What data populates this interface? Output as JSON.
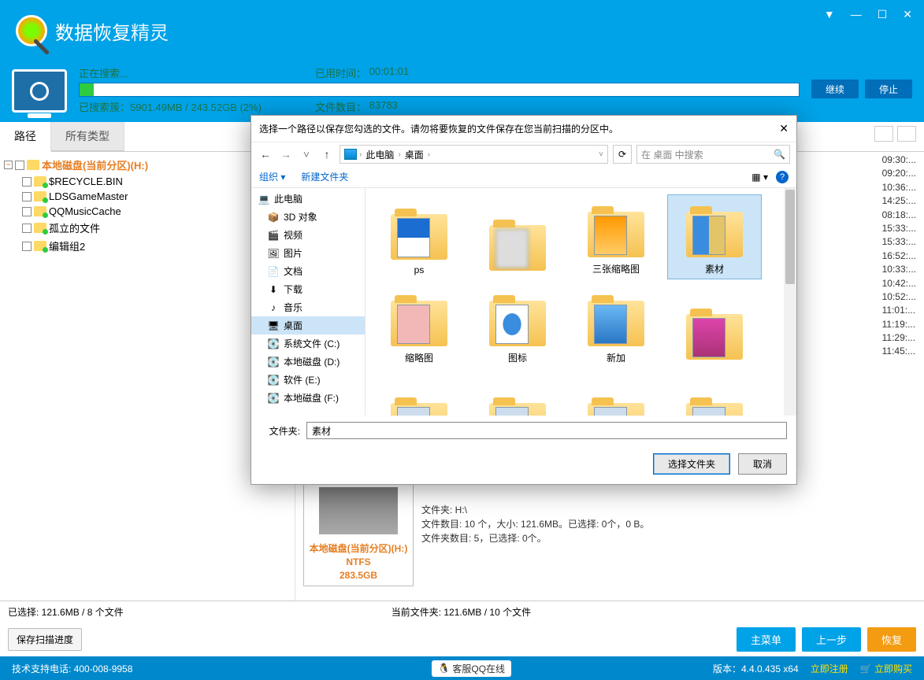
{
  "app": {
    "title_a": "数据恢复",
    "title_b": "精灵"
  },
  "progress": {
    "searching": "正在搜索...",
    "elapsed_lbl": "已用时间：",
    "elapsed_val": "00:01:01",
    "clusters_lbl": "已搜索簇：",
    "clusters_val": "5901.49MB / 243.52GB (2%)",
    "files_lbl": "文件数目：",
    "files_val": "83783",
    "btn_continue": "继续",
    "btn_stop": "停止"
  },
  "tabs": {
    "path": "路径",
    "types": "所有类型"
  },
  "tree": {
    "root": "本地磁盘(当前分区)(H:)",
    "items": [
      "$RECYCLE.BIN",
      "LDSGameMaster",
      "QQMusicCache",
      "孤立的文件",
      "编辑组2"
    ]
  },
  "timestamps": [
    "09:30:...",
    "09:20:...",
    "10:36:...",
    "14:25:...",
    "08:18:...",
    "15:33:...",
    "15:33:...",
    "16:52:...",
    "10:33:...",
    "10:42:...",
    "10:52:...",
    "11:01:...",
    "11:19:...",
    "11:29:...",
    "11:45:..."
  ],
  "preview": {
    "line1": "本地磁盘(当前分区)(H:)",
    "line2": "NTFS",
    "line3": "283.5GB",
    "info1": "文件夹: H:\\",
    "info2": "文件数目: 10 个，大小: 121.6MB。已选择: 0个，0 B。",
    "info3": "文件夹数目: 5，已选择: 0个。"
  },
  "status": {
    "selected": "已选择: 121.6MB / 8 个文件",
    "current": "当前文件夹: 121.6MB / 10 个文件",
    "save_progress": "保存扫描进度",
    "main_menu": "主菜单",
    "prev": "上一步",
    "recover": "恢复"
  },
  "footer": {
    "phone": "技术支持电话: 400-008-9958",
    "qq": "客服QQ在线",
    "version_lbl": "版本：",
    "version": "4.4.0.435 x64",
    "register": "立即注册",
    "buy": "立即购买"
  },
  "dialog": {
    "title": "选择一个路径以保存您勾选的文件。请勿将要恢复的文件保存在您当前扫描的分区中。",
    "breadcrumb": {
      "pc": "此电脑",
      "desktop": "桌面"
    },
    "search_ph": "在 桌面 中搜索",
    "organize": "组织",
    "newfolder": "新建文件夹",
    "sidebar": [
      {
        "label": "此电脑",
        "icon": "💻",
        "lv": 0
      },
      {
        "label": "3D 对象",
        "icon": "📦",
        "lv": 1
      },
      {
        "label": "视频",
        "icon": "🎬",
        "lv": 1
      },
      {
        "label": "图片",
        "icon": "🖼",
        "lv": 1
      },
      {
        "label": "文档",
        "icon": "📄",
        "lv": 1
      },
      {
        "label": "下载",
        "icon": "⬇",
        "lv": 1
      },
      {
        "label": "音乐",
        "icon": "♪",
        "lv": 1
      },
      {
        "label": "桌面",
        "icon": "🖥",
        "lv": 1,
        "sel": true
      },
      {
        "label": "系统文件 (C:)",
        "icon": "💽",
        "lv": 1
      },
      {
        "label": "本地磁盘 (D:)",
        "icon": "💽",
        "lv": 1
      },
      {
        "label": "软件 (E:)",
        "icon": "💽",
        "lv": 1
      },
      {
        "label": "本地磁盘 (F:)",
        "icon": "💽",
        "lv": 1
      }
    ],
    "files": [
      {
        "label": "ps",
        "cls": "ps"
      },
      {
        "label": "",
        "cls": "blur"
      },
      {
        "label": "三张缩略图",
        "cls": "card"
      },
      {
        "label": "素材",
        "cls": "sucai",
        "sel": true
      },
      {
        "label": "缩略图",
        "cls": "thumb"
      },
      {
        "label": "图标",
        "cls": "tubiao"
      },
      {
        "label": "新加",
        "cls": "xinjia"
      },
      {
        "label": "",
        "cls": "person"
      },
      {
        "label": "",
        "cls": ""
      },
      {
        "label": "",
        "cls": ""
      },
      {
        "label": "",
        "cls": ""
      },
      {
        "label": "",
        "cls": ""
      }
    ],
    "folder_lbl": "文件夹:",
    "folder_value": "素材",
    "btn_select": "选择文件夹",
    "btn_cancel": "取消"
  }
}
